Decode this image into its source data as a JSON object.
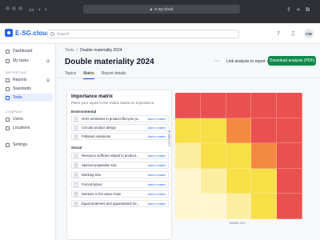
{
  "browser": {
    "url": "e-sg.cloud"
  },
  "header": {
    "logo": "E-SG.cloud",
    "search_placeholder": "Search",
    "avatar": "CW"
  },
  "sidebar": {
    "items": [
      {
        "label": "Dashboard",
        "icon": "dashboard-icon"
      },
      {
        "label": "My tasks",
        "icon": "tasks-icon",
        "badge": "4"
      }
    ],
    "reporting_label": "REPORTING",
    "reporting": [
      {
        "label": "Reports",
        "icon": "reports-icon",
        "badge": "0"
      },
      {
        "label": "Standards",
        "icon": "standards-icon"
      },
      {
        "label": "Tools",
        "icon": "tools-icon",
        "active": true
      }
    ],
    "company_label": "COMPANY",
    "company": [
      {
        "label": "Users",
        "icon": "users-icon"
      },
      {
        "label": "Locations",
        "icon": "locations-icon"
      }
    ],
    "settings": {
      "label": "Settings",
      "icon": "settings-icon"
    }
  },
  "breadcrumb": {
    "root": "Tools",
    "sep": "/",
    "current": "Double materiality 2024"
  },
  "page": {
    "title": "Double materiality 2024",
    "link_button": "Link analysis to report",
    "download_button": "Download analysis (PDF)"
  },
  "tabs": [
    "Topics",
    "Matrix",
    "Report details"
  ],
  "active_tab": "Matrix",
  "panel": {
    "title": "Importance matrix",
    "description": "Place your topics in the matrix based on importance.",
    "groups": [
      {
        "name": "Environmental",
        "topics": [
          {
            "num": "1",
            "name": "GHG emissions in product lifecycle (a...",
            "action": "Add to matrix"
          },
          {
            "num": "2",
            "name": "Circular product design",
            "action": "Add to matrix"
          },
          {
            "num": "3",
            "name": "Pollutant emissions",
            "action": "Add to matrix"
          }
        ]
      },
      {
        "name": "Social",
        "topics": [
          {
            "num": "4",
            "name": "Resource sufficies related to product...",
            "action": "Add to matrix"
          },
          {
            "num": "5",
            "name": "Species population size",
            "action": "Add to matrix"
          },
          {
            "num": "6",
            "name": "Working time",
            "action": "Add to matrix"
          },
          {
            "num": "7",
            "name": "Forced labour",
            "action": "Add to matrix"
          },
          {
            "num": "8",
            "name": "Workers in the value chain",
            "action": "Add to matrix"
          },
          {
            "num": "9",
            "name": "Equal treatment and opportunities for...",
            "action": "Add to matrix"
          }
        ]
      }
    ]
  },
  "matrix": {
    "y_axis_label": "OUTSIDE-IN",
    "x_axis_label": "INSIDE-OUT",
    "colors": {
      "red": "#e8514f",
      "orange": "#f48a3f",
      "yellow": "#f8df48",
      "light_yellow": "#fbeea0",
      "pale": "#fdf6cf"
    },
    "grid": [
      [
        "red",
        "red",
        "red",
        "red",
        "red"
      ],
      [
        "yellow",
        "yellow",
        "orange",
        "red",
        "red"
      ],
      [
        "light_yellow",
        "yellow",
        "yellow",
        "orange",
        "red"
      ],
      [
        "pale",
        "light_yellow",
        "yellow",
        "yellow",
        "red"
      ],
      [
        "pale",
        "pale",
        "light_yellow",
        "yellow",
        "red"
      ]
    ]
  }
}
